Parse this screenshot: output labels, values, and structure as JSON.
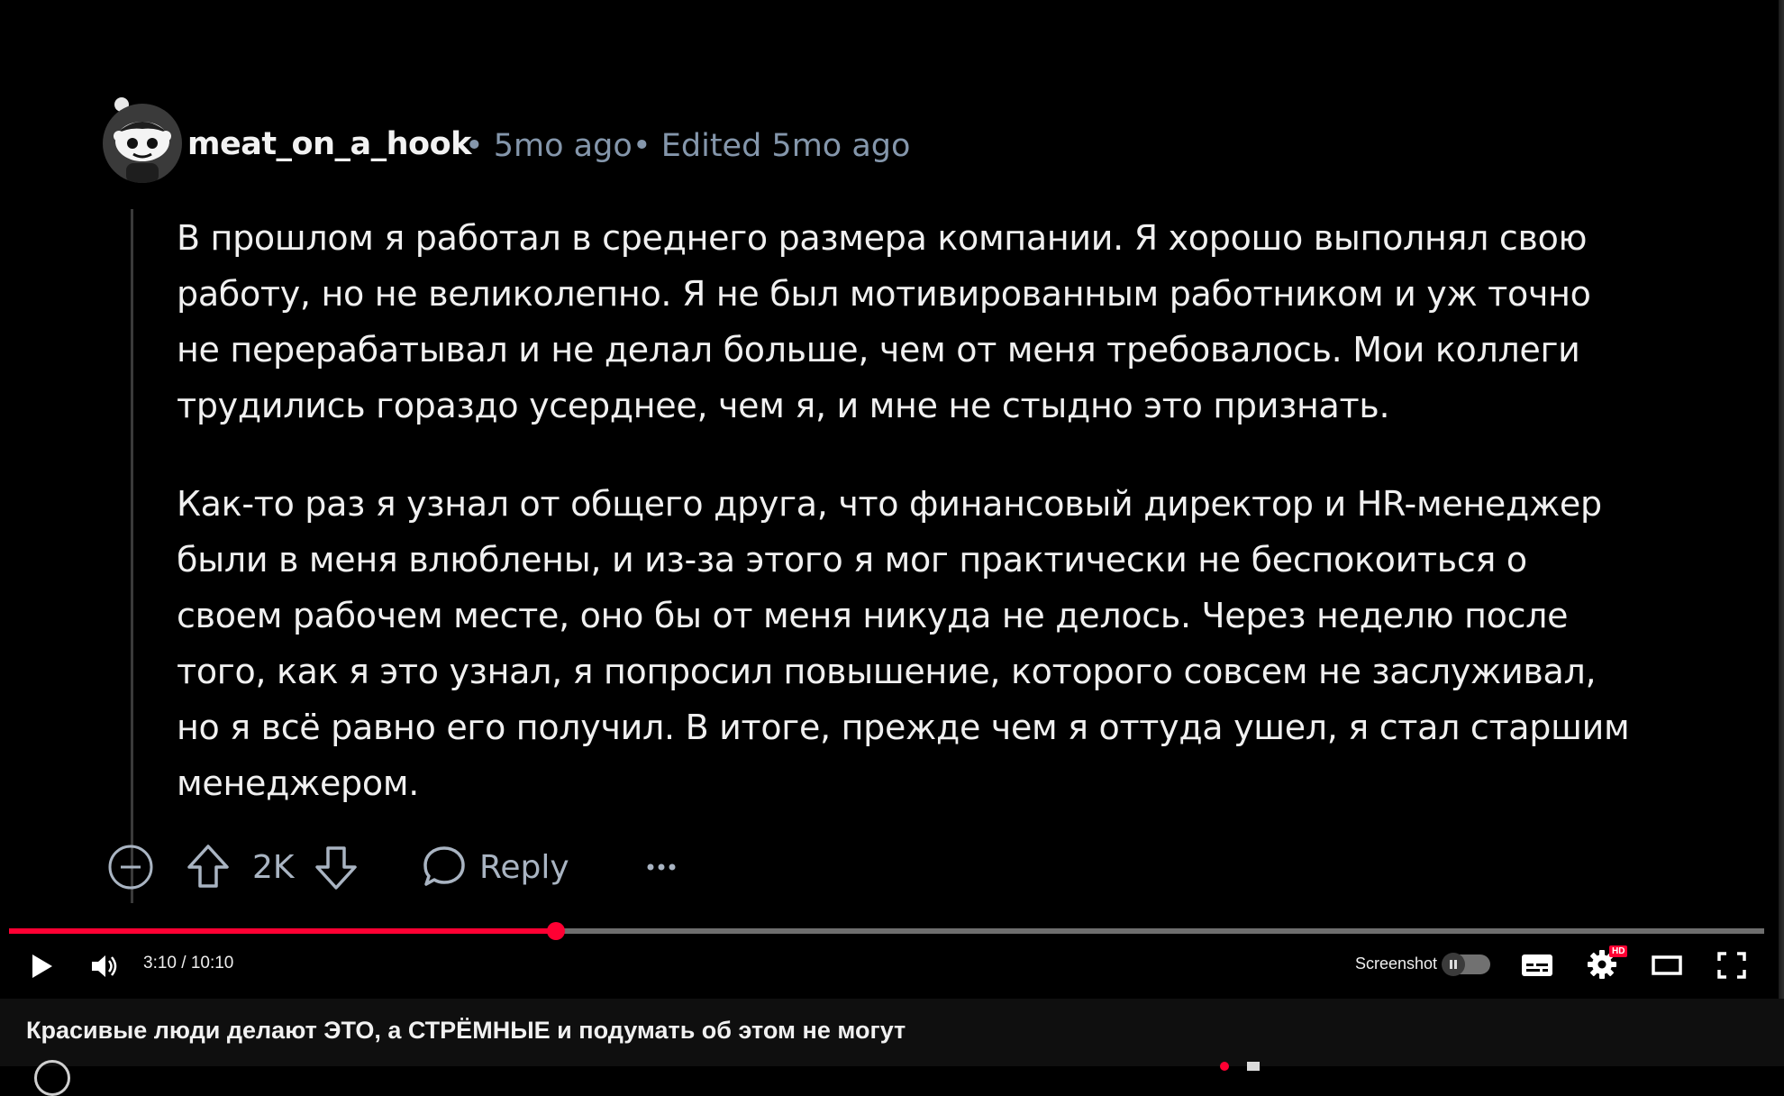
{
  "comment": {
    "username": "meat_on_a_hook",
    "time": "• 5mo ago",
    "edited": "• Edited 5mo ago",
    "paragraph1_lines": [
      "В прошлом я работал в среднего размера компании. Я хорошо выполнял свою",
      "работу, но не великолепно. Я не был мотивированным работником и уж точно",
      "не перерабатывал и не делал больше, чем от меня требовалось. Мои коллеги",
      "трудились гораздо усерднее, чем я, и мне не стыдно это признать."
    ],
    "paragraph2_lines": [
      "Как-то раз я узнал от общего друга, что финансовый директор и HR-менеджер",
      "были в меня влюблены, и из-за этого я мог практически не беспокоиться о",
      "своем рабочем месте, оно бы от меня никуда не делось. Через неделю после",
      "того, как я это узнал, я попросил повышение, которого совсем не заслуживал,",
      "но я всё равно его получил. В итоге, прежде чем я оттуда ушел, я стал старшим",
      "менеджером."
    ],
    "vote_count": "2K",
    "reply_label": "Reply",
    "icons": [
      "collapse-icon",
      "upvote-icon",
      "downvote-icon",
      "comment-icon",
      "more-icon"
    ]
  },
  "player": {
    "current_time": "3:10",
    "separator": " / ",
    "duration": "10:10",
    "progress": 0.3115,
    "screenshot_label": "Screenshot",
    "hd_badge": "HD",
    "accent_color": "#ff0033",
    "icons": [
      "play-icon",
      "volume-icon",
      "pause-icon",
      "subtitles-icon",
      "settings-icon",
      "theater-icon",
      "fullscreen-icon"
    ]
  },
  "video": {
    "title": "Красивые люди делают ЭТО, а СТРЁМНЫЕ и подумать об этом не могут"
  }
}
